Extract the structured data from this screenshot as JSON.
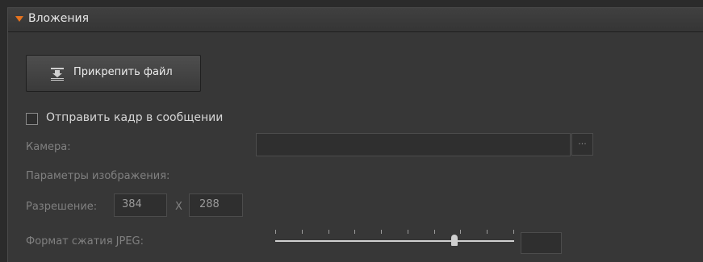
{
  "panel": {
    "title": "Вложения",
    "attach_button_label": "Прикрепить файл",
    "send_frame_label": "Отправить кадр в сообщении",
    "send_frame_checked": false,
    "camera_label": "Камера:",
    "camera_value": "",
    "browse_label": "...",
    "image_params_label": "Параметры изображения:",
    "resolution_label": "Разрешение:",
    "width_value": "384",
    "separator": "X",
    "height_value": "288",
    "jpeg_label": "Формат сжатия JPEG:",
    "jpeg_value": "",
    "jpeg_slider_level": 0.75,
    "jpeg_slider_ticks": 10
  },
  "colors": {
    "background": "#2b2b2b",
    "panel": "#373737",
    "accent_triangle": "#e6731e",
    "muted_text": "#808080"
  },
  "icons": {
    "collapse": "triangle-down-icon",
    "attach": "attach-download-icon"
  }
}
